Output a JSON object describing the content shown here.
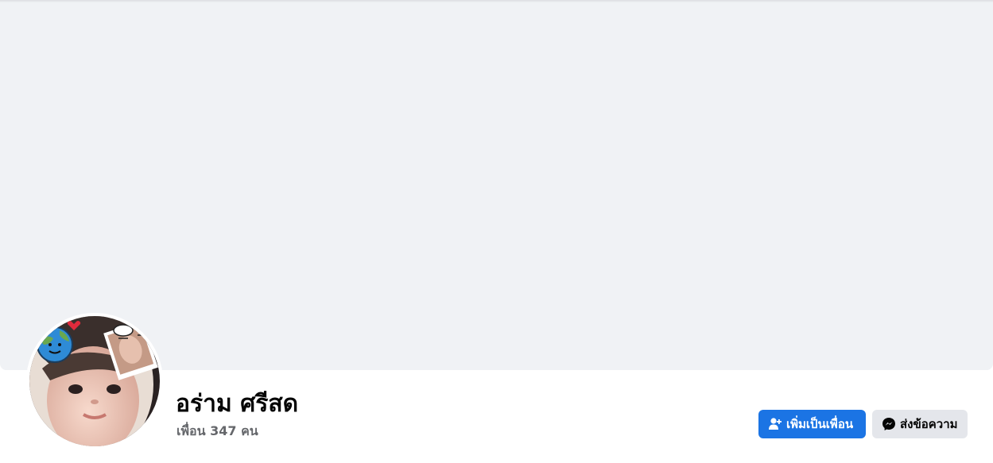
{
  "profile": {
    "name": "อร่าม ศรีสด",
    "friends_count_text": "เพื่อน 347 คน"
  },
  "actions": {
    "add_friend_label": "เพิ่มเป็นเพื่อน",
    "message_label": "ส่งข้อความ"
  },
  "colors": {
    "primary_button": "#1b74e4",
    "secondary_button": "#e4e6eb",
    "cover_placeholder": "#f0f2f5",
    "secondary_text": "#65676b"
  },
  "icons": {
    "add_friend": "add-friend-icon",
    "message": "messenger-icon"
  }
}
